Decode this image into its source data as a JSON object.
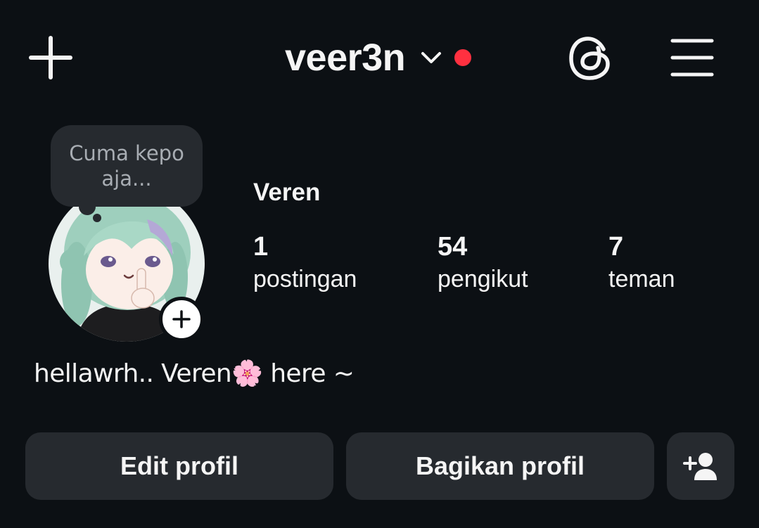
{
  "header": {
    "username": "veer3n",
    "icons": {
      "new_post": "plus-icon",
      "switch_account": "chevron-down-icon",
      "threads": "threads-icon",
      "menu": "hamburger-menu-icon"
    },
    "notification_dot_color": "#ff3040"
  },
  "note": {
    "text": "Cuma kepo aja..."
  },
  "profile": {
    "display_name": "Veren",
    "bio": "hellawrh.. Veren🌸 here ~",
    "stats": [
      {
        "value": "1",
        "label": "postingan"
      },
      {
        "value": "54",
        "label": "pengikut"
      },
      {
        "value": "7",
        "label": "teman"
      }
    ]
  },
  "actions": {
    "edit_profile": "Edit profil",
    "share_profile": "Bagikan profil",
    "add_user_icon": "add-user-icon"
  },
  "colors": {
    "background": "#0c1014",
    "button_bg": "#262a2f",
    "text": "#f5f5f5"
  }
}
